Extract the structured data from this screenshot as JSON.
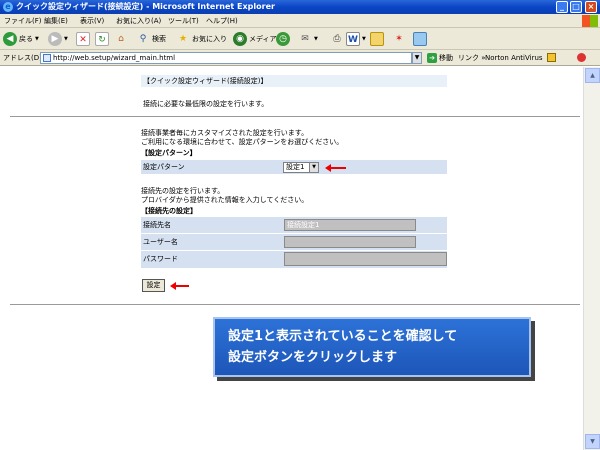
{
  "window": {
    "title": "クイック設定ウィザード(接続設定) - Microsoft Internet Explorer",
    "app_icon": "ie-icon",
    "controls": [
      "_",
      "□",
      "×"
    ]
  },
  "menu": {
    "items": [
      "ファイル(F)",
      "編集(E)",
      "表示(V)",
      "お気に入り(A)",
      "ツール(T)",
      "ヘルプ(H)"
    ]
  },
  "toolbar": {
    "back_label": "戻る",
    "search_label": "検索",
    "favorites_label": "お気に入り",
    "media_label": "メディア"
  },
  "address": {
    "label": "アドレス(D)",
    "url": "http://web.setup/wizard_main.html",
    "go_label": "移動",
    "links_label": "リンク »",
    "norton_label": "Norton AntiVirus"
  },
  "page": {
    "header": "【クイック設定ウィザード(接続設定)】",
    "intro": "接続に必要な最低限の設定を行います。",
    "pattern_desc1": "接続事業者毎にカスタマイズされた設定を行います。",
    "pattern_desc2": "ご利用になる環境に合わせて、設定パターンをお選びください。",
    "pattern_title": "【設定パターン】",
    "pattern_label": "設定パターン",
    "pattern_value": "設定1",
    "dest_desc1": "接続先の設定を行います。",
    "dest_desc2": "プロバイダから提供された情報を入力してください。",
    "dest_title": "【接続先の設定】",
    "dest_name_label": "接続先名",
    "dest_name_value": "接続設定1",
    "user_label": "ユーザー名",
    "password_label": "パスワード",
    "submit_label": "設定"
  },
  "callout": {
    "line1": "設定1と表示されていることを確認して",
    "line2": "設定ボタンをクリックします"
  },
  "colors": {
    "titlebar": "#0a46c6",
    "callout_bg": "#1d56b8",
    "row_bg": "#d5e1f0",
    "arrow": "#ee0000"
  }
}
